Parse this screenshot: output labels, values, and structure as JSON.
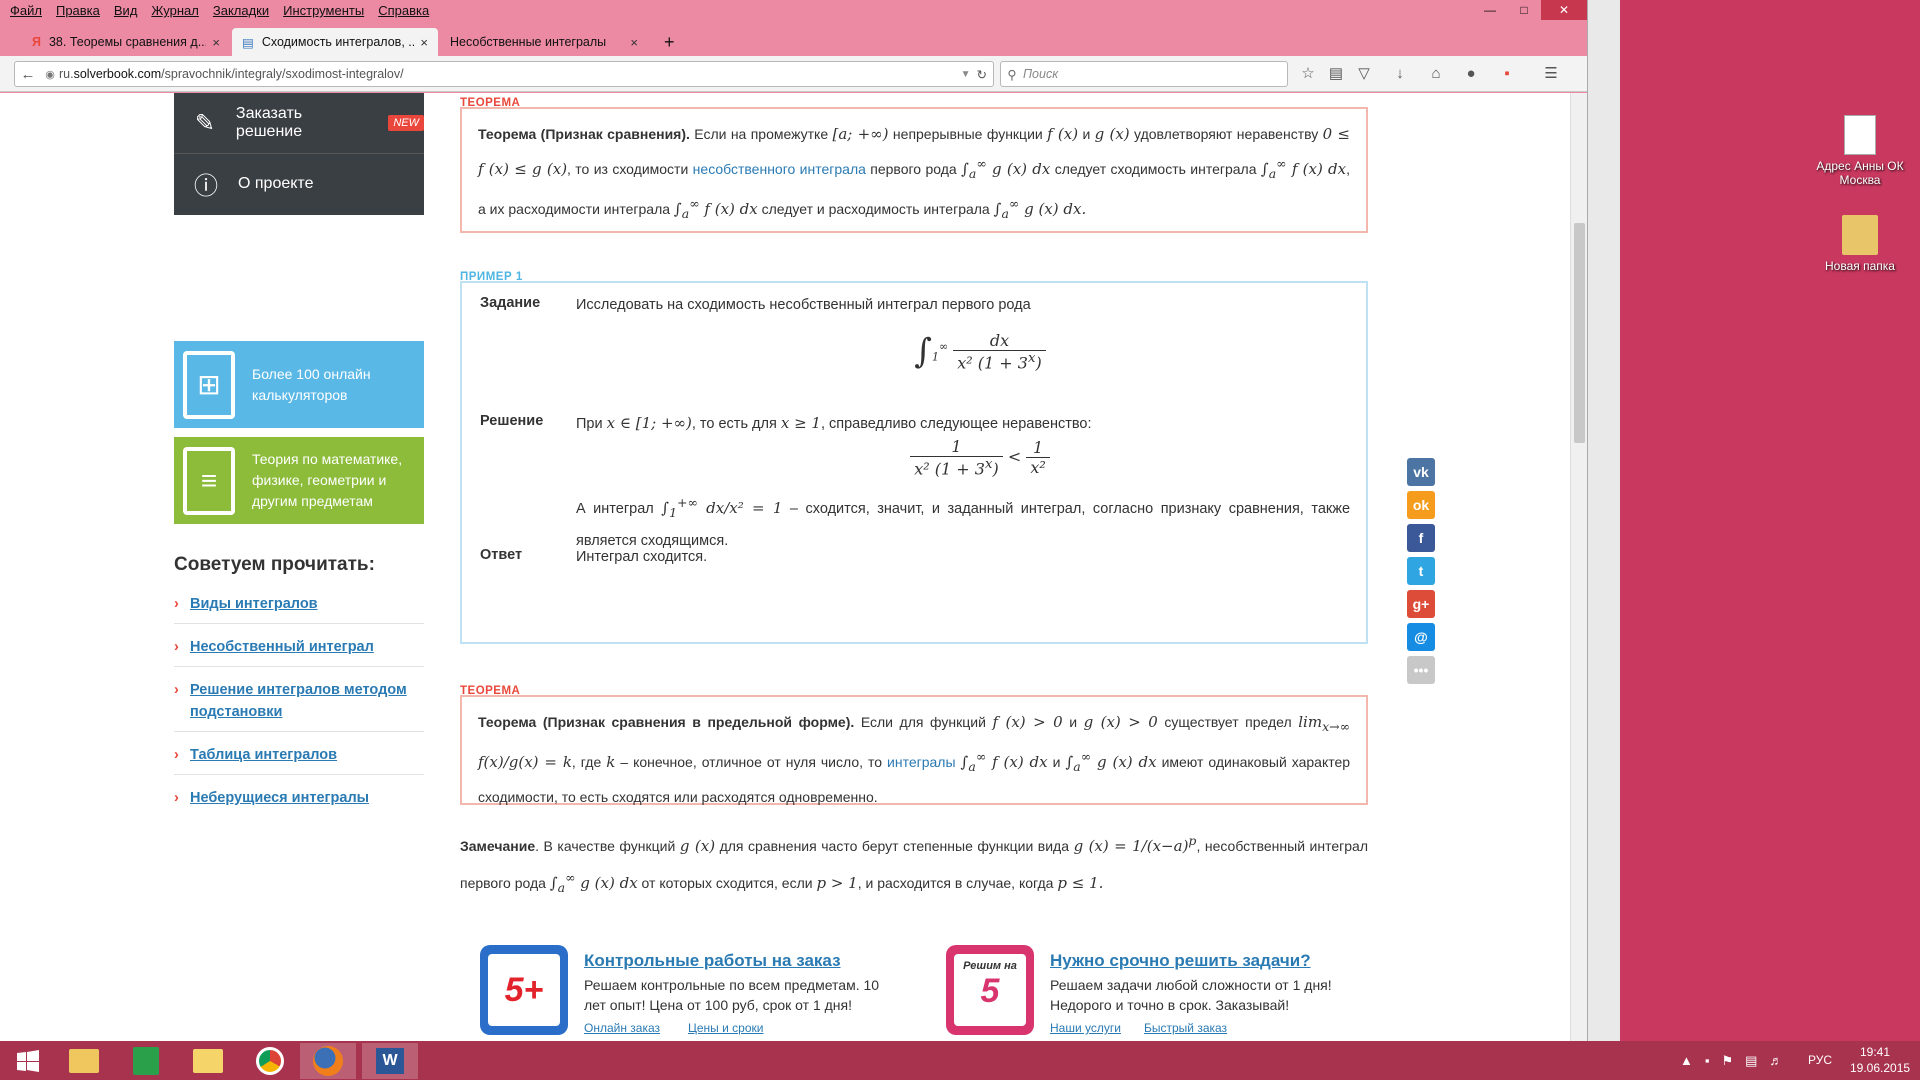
{
  "browser": {
    "menu": [
      "Файл",
      "Правка",
      "Вид",
      "Журнал",
      "Закладки",
      "Инструменты",
      "Справка"
    ],
    "tabs": [
      {
        "label": "38. Теоремы сравнения д...",
        "close": "×"
      },
      {
        "label": "Сходимость интегралов, ...",
        "close": "×"
      },
      {
        "label": "Несобственные интегралы",
        "close": "×"
      }
    ],
    "new_tab": "+",
    "url_plain": "ru.",
    "url_domain": "solverbook.com",
    "url_path": "/spravochnik/integraly/sxodimost-integralov/",
    "search_placeholder": "Поиск"
  },
  "sidebar": {
    "order_label": "Заказать решение",
    "new_badge": "NEW",
    "about_label": "О проекте",
    "calc_label": "Более 100 онлайн калькуляторов",
    "theory_label": "Теория по математике, физике, геометрии и другим предметам",
    "reco_title": "Советуем прочитать:",
    "reco": [
      "Виды интегралов",
      "Несобственный интеграл",
      "Решение интегралов методом подстановки",
      "Таблица интегралов",
      "Неберущиеся интегралы"
    ]
  },
  "theorem1": {
    "label": "ТЕОРЕМА",
    "title": "Теорема (Признак сравнения).",
    "t1": "Если на промежутке",
    "t2": "непрерывные функции",
    "t3": "и",
    "t4": "удовлетворяют неравенству",
    "t5": ", то из сходимости",
    "link": "несобственного интеграла",
    "t6": "первого рода",
    "t7": "следует сходимость интеграла",
    "t8": ", а их расходимости интеграла",
    "t9": "следует и расходимость интеграла"
  },
  "example": {
    "label": "ПРИМЕР 1",
    "task_label": "Задание",
    "task_text": "Исследовать на сходимость несобственный интеграл первого рода",
    "solution_label": "Решение",
    "sol_t1": "При",
    "sol_t2": ", то есть для",
    "sol_t3": ", справедливо следующее неравенство:",
    "sol_t4": "А интеграл",
    "sol_t5": "– сходится, значит, и заданный интеграл, согласно признаку сравнения, также является сходящимся.",
    "answer_label": "Ответ",
    "answer_text": "Интеграл сходится."
  },
  "theorem2": {
    "label": "ТЕОРЕМА",
    "title": "Теорема (Признак сравнения в предельной форме).",
    "t1": "Если для функций",
    "t2": "и",
    "t3": "существует предел",
    "t4": ", где",
    "t5": "– конечное, отличное от нуля число, то",
    "link": "интегралы",
    "t6": "и",
    "t7": "имеют одинаковый характер сходимости, то есть сходятся или расходятся одновременно."
  },
  "remark": {
    "title": "Замечание",
    "t1": ". В качестве функций",
    "t2": "для сравнения часто берут степенные функции вида",
    "t3": ", несобственный интеграл первого рода",
    "t4": "от которых сходится, если",
    "t5": ", и расходится в случае, когда"
  },
  "ads": [
    {
      "title": "Контрольные работы на заказ",
      "text": "Решаем контрольные по всем предметам. 10 лет опыт! Цена от 100 руб, срок от 1 дня!",
      "links": [
        "Онлайн заказ",
        "Цены и сроки"
      ],
      "badge": "5+"
    },
    {
      "title": "Нужно срочно решить задачи?",
      "text": "Решаем задачи любой сложности от 1 дня! Недорого и точно в срок. Заказывай!",
      "links": [
        "Наши услуги",
        "Быстрый заказ"
      ],
      "badge_top": "Решим на",
      "badge_num": "5"
    }
  ],
  "social": [
    "vk",
    "ok",
    "f",
    "t",
    "g+",
    "@",
    "•••"
  ],
  "desktop": {
    "icon1": "Адрес Анны ОК Москва",
    "icon2": "Новая папка"
  },
  "taskbar": {
    "lang": "РУС",
    "time": "19:41",
    "date": "19.06.2015"
  },
  "colors": {
    "accent_red": "#e9473b",
    "accent_blue": "#4fb5e2",
    "link": "#2a7ab3",
    "green": "#8cbc3a"
  }
}
